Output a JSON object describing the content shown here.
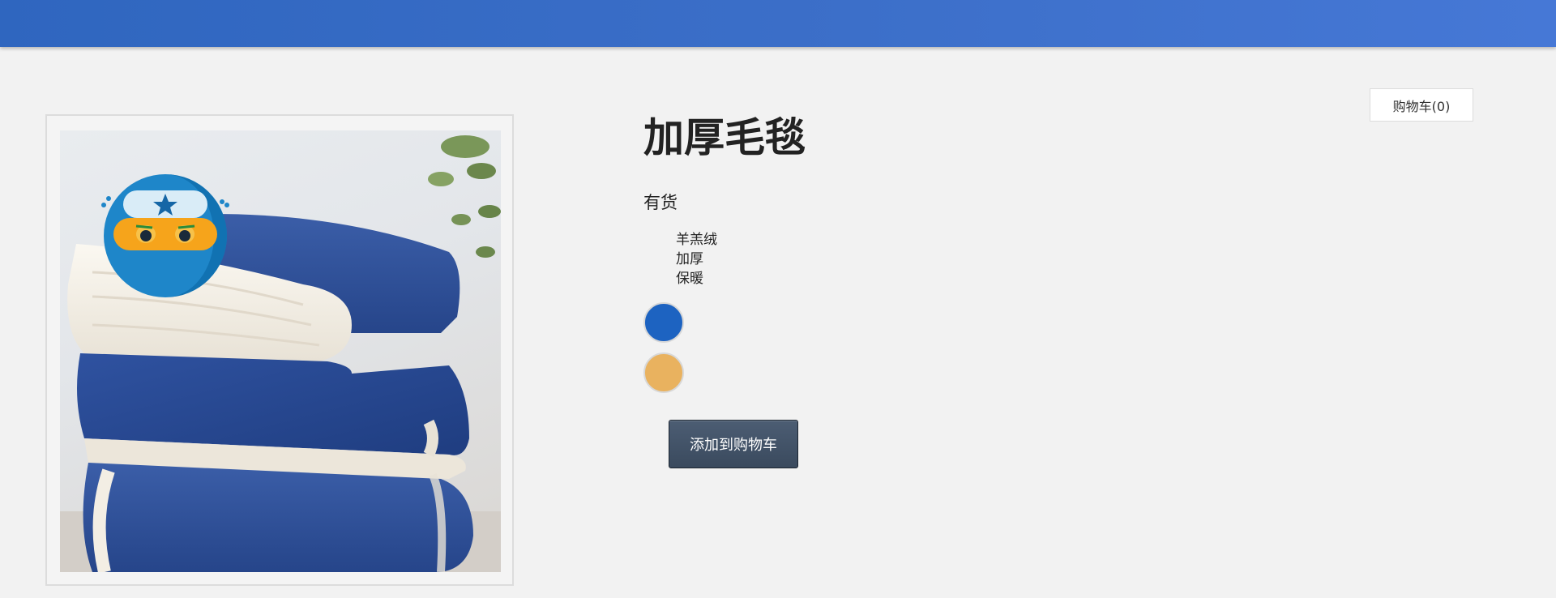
{
  "header": {
    "bar_color": "#3c6fc9"
  },
  "cart": {
    "label": "购物车(0)"
  },
  "product": {
    "title": "加厚毛毯",
    "stock_status": "有货",
    "features": [
      "羊羔绒",
      "加厚",
      "保暖"
    ],
    "image_subject": "folded navy blue blanket with white sherpa lining",
    "badge_icon": "ninja-mascot-icon",
    "swatches": [
      {
        "name": "blue",
        "color": "#1d63c1"
      },
      {
        "name": "gold",
        "color": "#e9b25f"
      }
    ],
    "add_to_cart_label": "添加到购物车"
  }
}
